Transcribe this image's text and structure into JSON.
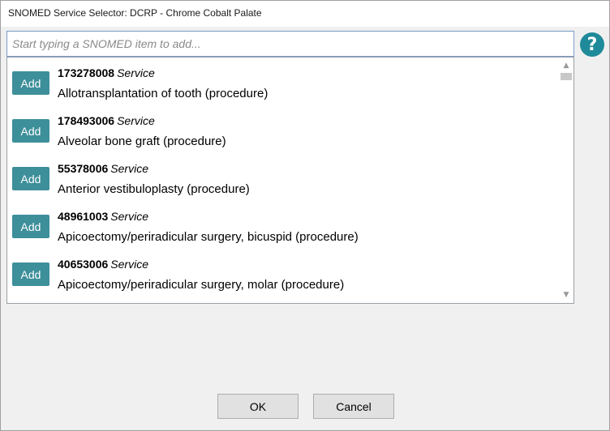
{
  "window": {
    "title": "SNOMED Service Selector: DCRP - Chrome Cobalt Palate"
  },
  "search": {
    "placeholder": "Start typing a SNOMED item to add...",
    "value": ""
  },
  "help": {
    "label": "?",
    "icon": "help-question-icon",
    "color": "#1f8a99"
  },
  "list": {
    "add_label": "Add",
    "add_color": "#3d8f9a",
    "items": [
      {
        "code": "173278008",
        "type": "Service",
        "description": "Allotransplantation of tooth (procedure)"
      },
      {
        "code": "178493006",
        "type": "Service",
        "description": "Alveolar bone graft (procedure)"
      },
      {
        "code": "55378006",
        "type": "Service",
        "description": "Anterior vestibuloplasty (procedure)"
      },
      {
        "code": "48961003",
        "type": "Service",
        "description": "Apicoectomy/periradicular surgery, bicuspid (procedure)"
      },
      {
        "code": "40653006",
        "type": "Service",
        "description": "Apicoectomy/periradicular surgery, molar (procedure)"
      }
    ]
  },
  "scrollbar": {
    "up_icon": "scroll-up-arrow-icon",
    "down_icon": "scroll-down-arrow-icon"
  },
  "buttons": {
    "ok": "OK",
    "cancel": "Cancel"
  }
}
